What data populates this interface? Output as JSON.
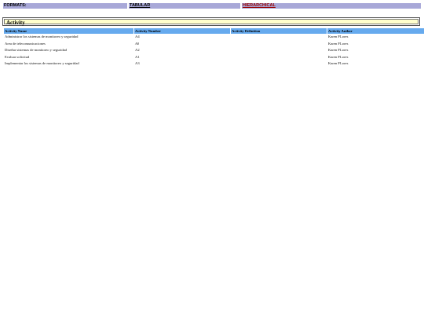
{
  "formats": {
    "label": "FORMATS:",
    "tabular": "TABULAR",
    "hierarchical": "HIERARCHICAL"
  },
  "title": "Activity",
  "table": {
    "headers": [
      "Activity Name",
      "Activity Number",
      "Activity Definition",
      "Activity Author"
    ],
    "rows": [
      [
        "Administrar los sistemas de monitoreo y seguridad",
        "A4",
        "",
        "Karen FLores"
      ],
      [
        "Area de telecomunicaciones",
        "A0",
        "",
        "Karen FLores"
      ],
      [
        "Diseñar sistemas de  monitoreo  y seguridad",
        "A2",
        "",
        "Karen FLores"
      ],
      [
        "Evaluar solicitud",
        "A1",
        "",
        "Karen FLores"
      ],
      [
        "Implementar los sistemas  de monitoreo y seguridad",
        "A3",
        "",
        "Karen FLores"
      ]
    ]
  }
}
